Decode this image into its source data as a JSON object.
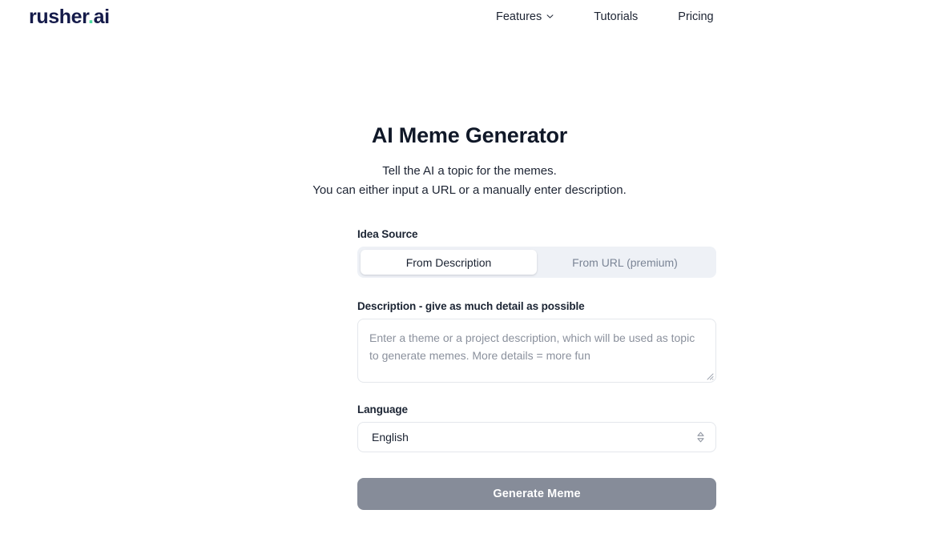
{
  "header": {
    "logo": {
      "name": "rusher",
      "dot": ".",
      "suffix": "ai"
    },
    "nav": [
      {
        "label": "Features",
        "has_dropdown": true,
        "icon": "chevron-down-icon"
      },
      {
        "label": "Tutorials",
        "has_dropdown": false
      },
      {
        "label": "Pricing",
        "has_dropdown": false
      }
    ]
  },
  "main": {
    "title": "AI Meme Generator",
    "subtitle_line1": "Tell the AI a topic for the memes.",
    "subtitle_line2": "You can either input a URL or a manually enter description.",
    "idea_source": {
      "label": "Idea Source",
      "options": [
        {
          "label": "From Description",
          "selected": true
        },
        {
          "label": "From URL (premium)",
          "selected": false
        }
      ]
    },
    "description": {
      "label": "Description - give as much detail as possible",
      "value": "",
      "placeholder": "Enter a theme or a project description, which will be used as topic to generate memes. More details = more fun",
      "resize_icon": "resize-handle-icon"
    },
    "language": {
      "label": "Language",
      "selected": "English",
      "options": [
        "English"
      ],
      "icon": "select-chevrons-icon"
    },
    "submit": {
      "label": "Generate Meme",
      "disabled": true
    }
  },
  "colors": {
    "logo_text": "#151b4a",
    "logo_dot": "#4edba0",
    "title": "#101828",
    "segmented_track": "#eef1f6",
    "segmented_active_bg": "#ffffff",
    "segmented_inactive_text": "#7b8596",
    "field_border": "#e4e7ec",
    "placeholder": "#8b919d",
    "button_bg": "#868c99",
    "button_text": "#ffffff"
  }
}
